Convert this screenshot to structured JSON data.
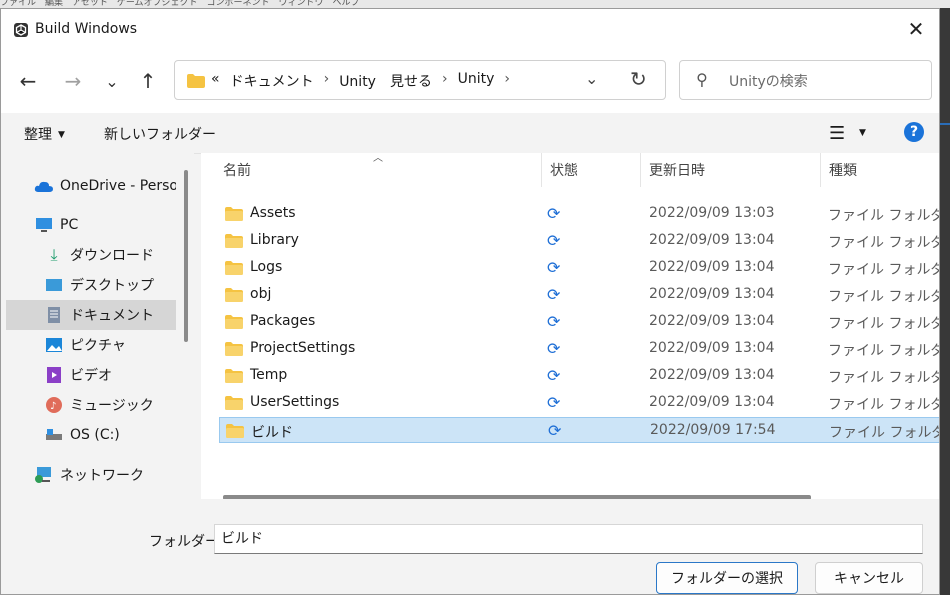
{
  "background": {
    "menu_text": "ファイル　編集　アセット　ゲームオブジェクト　コンポーネント　ウィンドウ　ヘルプ"
  },
  "window": {
    "title": "Build Windows",
    "close_glyph": "✕"
  },
  "navigation": {
    "back_glyph": "←",
    "forward_glyph": "→",
    "recent_glyph": "⌄",
    "up_glyph": "↑",
    "address": {
      "overflow": "«",
      "crumbs": [
        "ドキュメント",
        "Unity　見せる",
        "Unity"
      ],
      "separator": "›"
    },
    "search_placeholder": "Unityの検索"
  },
  "toolbar": {
    "organize_label": "整理",
    "new_folder_label": "新しいフォルダー"
  },
  "sidebar": {
    "items": [
      {
        "label": "OneDrive - Personal",
        "icon": "cloud-icon"
      },
      {
        "label": "PC",
        "icon": "monitor-icon"
      },
      {
        "label": "ダウンロード",
        "icon": "download-icon"
      },
      {
        "label": "デスクトップ",
        "icon": "desktop-icon"
      },
      {
        "label": "ドキュメント",
        "icon": "document-icon",
        "selected": true
      },
      {
        "label": "ピクチャ",
        "icon": "pictures-icon"
      },
      {
        "label": "ビデオ",
        "icon": "video-icon"
      },
      {
        "label": "ミュージック",
        "icon": "music-icon"
      },
      {
        "label": "OS (C:)",
        "icon": "drive-icon"
      },
      {
        "label": "ネットワーク",
        "icon": "network-icon"
      }
    ]
  },
  "file_list": {
    "columns": [
      "名前",
      "状態",
      "更新日時",
      "種類"
    ],
    "rows": [
      {
        "name": "Assets",
        "date": "2022/09/09 13:03",
        "type": "ファイル フォルダー"
      },
      {
        "name": "Library",
        "date": "2022/09/09 13:04",
        "type": "ファイル フォルダー"
      },
      {
        "name": "Logs",
        "date": "2022/09/09 13:04",
        "type": "ファイル フォルダー"
      },
      {
        "name": "obj",
        "date": "2022/09/09 13:04",
        "type": "ファイル フォルダー"
      },
      {
        "name": "Packages",
        "date": "2022/09/09 13:04",
        "type": "ファイル フォルダー"
      },
      {
        "name": "ProjectSettings",
        "date": "2022/09/09 13:04",
        "type": "ファイル フォルダー"
      },
      {
        "name": "Temp",
        "date": "2022/09/09 13:04",
        "type": "ファイル フォルダー"
      },
      {
        "name": "UserSettings",
        "date": "2022/09/09 13:04",
        "type": "ファイル フォルダー"
      },
      {
        "name": "ビルド",
        "date": "2022/09/09 17:54",
        "type": "ファイル フォルダー",
        "selected": true
      }
    ],
    "sync_glyph": "⟳"
  },
  "bottom": {
    "folder_label": "フォルダー:",
    "folder_value": "ビルド",
    "select_button": "フォルダーの選択",
    "cancel_button": "キャンセル"
  },
  "colors": {
    "accent": "#1a73d9",
    "selection_bg": "#cce4f7",
    "folder": "#f5c342"
  }
}
